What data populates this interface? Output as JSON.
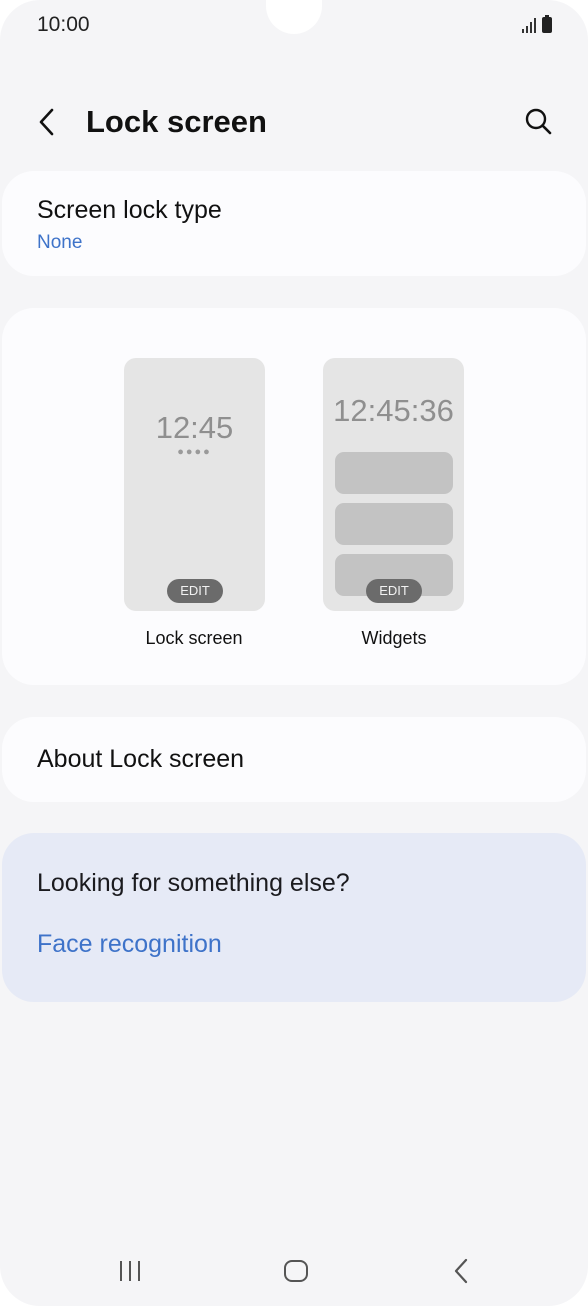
{
  "status_bar": {
    "time": "10:00",
    "signal_icon": "signal-icon",
    "battery_icon": "battery-icon"
  },
  "header": {
    "title": "Lock screen",
    "back_icon": "chevron-left-icon",
    "search_icon": "search-icon"
  },
  "screen_lock_type": {
    "label": "Screen lock type",
    "value": "None"
  },
  "previews": {
    "lock_screen": {
      "clock": "12:45",
      "dots": "●●●●",
      "edit_label": "EDIT",
      "caption": "Lock screen"
    },
    "widgets": {
      "clock": "12:45:36",
      "edit_label": "EDIT",
      "caption": "Widgets"
    }
  },
  "about": {
    "label": "About Lock screen"
  },
  "looking": {
    "title": "Looking for something else?",
    "link": "Face recognition"
  },
  "nav_bar": {
    "recents_icon": "recents-icon",
    "home_icon": "home-icon",
    "back_icon": "back-icon"
  },
  "colors": {
    "background": "#f5f5f7",
    "card": "#fcfcfe",
    "accent_link": "#3e73c9",
    "suggestion_card": "#e6eaf6"
  }
}
